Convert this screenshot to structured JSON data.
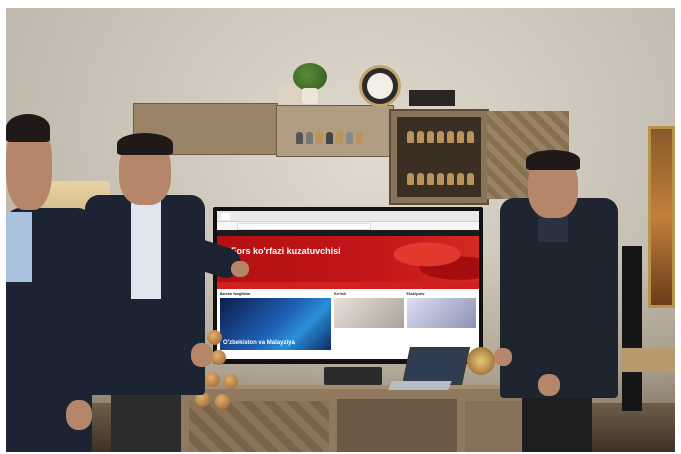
{
  "scene": {
    "colors": {
      "wall": "#d6cdbf",
      "tv_red": "#c2161a",
      "suit": "#1c2333",
      "wood": "#8f7a60"
    }
  },
  "screen": {
    "hero_title": "Fors ko'rfazi kuzatuvchisi",
    "section_left": "Barcha Yangiliklar",
    "section_mid": "Ko'rish",
    "section_right": "Eksklyuziv",
    "image_caption": "O'zbekiston va Malayziya"
  }
}
